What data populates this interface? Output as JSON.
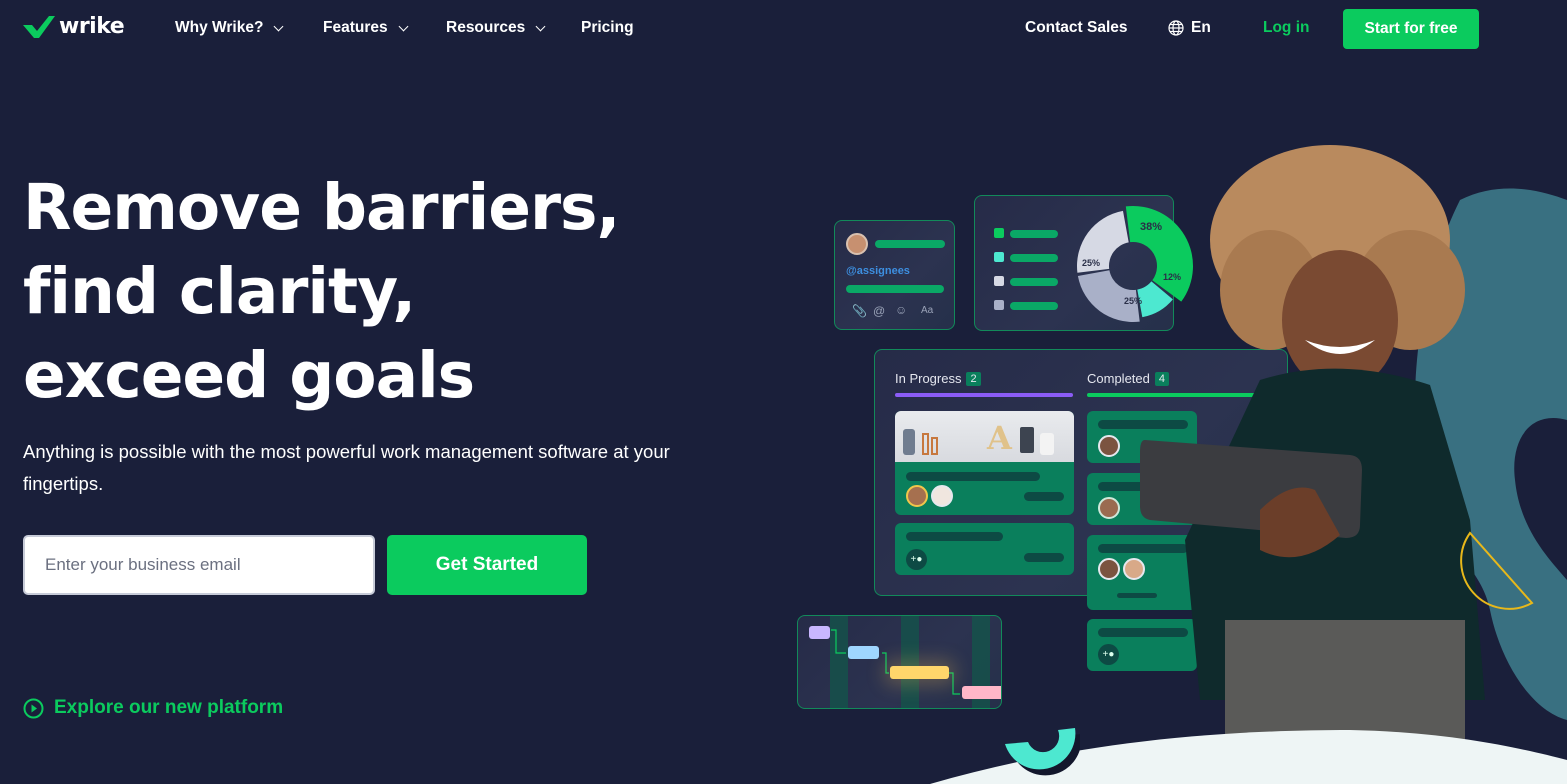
{
  "brand": {
    "name": "wrike",
    "accent": "#0bcb5e",
    "background": "#1a1f3a"
  },
  "nav": {
    "items": [
      {
        "label": "Why Wrike?",
        "has_dropdown": true
      },
      {
        "label": "Features",
        "has_dropdown": true
      },
      {
        "label": "Resources",
        "has_dropdown": true
      },
      {
        "label": "Pricing",
        "has_dropdown": false
      }
    ],
    "contact_sales": "Contact Sales",
    "language": {
      "icon": "globe-icon",
      "label": "En"
    },
    "login": "Log in",
    "start_free": "Start for free"
  },
  "hero": {
    "headline": [
      "Remove barriers,",
      "find clarity,",
      "exceed goals"
    ],
    "subtitle": "Anything is possible with the most powerful work management software at your fingertips.",
    "email_placeholder": "Enter your business email",
    "email_value": "",
    "get_started": "Get Started",
    "explore": {
      "icon": "play-circle-icon",
      "label": "Explore our new platform"
    }
  },
  "illustration": {
    "comment_card": {
      "mention": "@assignees",
      "toolbar_icons": [
        "paperclip-icon",
        "at-icon",
        "emoji-icon",
        "text-format-icon"
      ],
      "toolbar_text": "Aa"
    },
    "donut_chart": {
      "segments": [
        {
          "label": "38%",
          "value": 38,
          "color": "#0bcb5e"
        },
        {
          "label": "12%",
          "value": 12,
          "color": "#4de8d0"
        },
        {
          "label": "25%",
          "value": 25,
          "color": "#a9b0c8"
        },
        {
          "label": "25%",
          "value": 25,
          "color": "#d6d9e4"
        }
      ],
      "legend_colors": [
        "#0bcb5e",
        "#4de8d0",
        "#d6d9e4",
        "#a9b0c8"
      ]
    },
    "kanban": {
      "columns": [
        {
          "title": "In Progress",
          "count": "2",
          "color": "#8b5cf6"
        },
        {
          "title": "Completed",
          "count": "4",
          "color": "#0bcb5e"
        }
      ]
    },
    "gantt": {
      "bars": [
        "#c9b6ff",
        "#9fd6ff",
        "#ffd66b",
        "#ffb6c8"
      ]
    }
  }
}
